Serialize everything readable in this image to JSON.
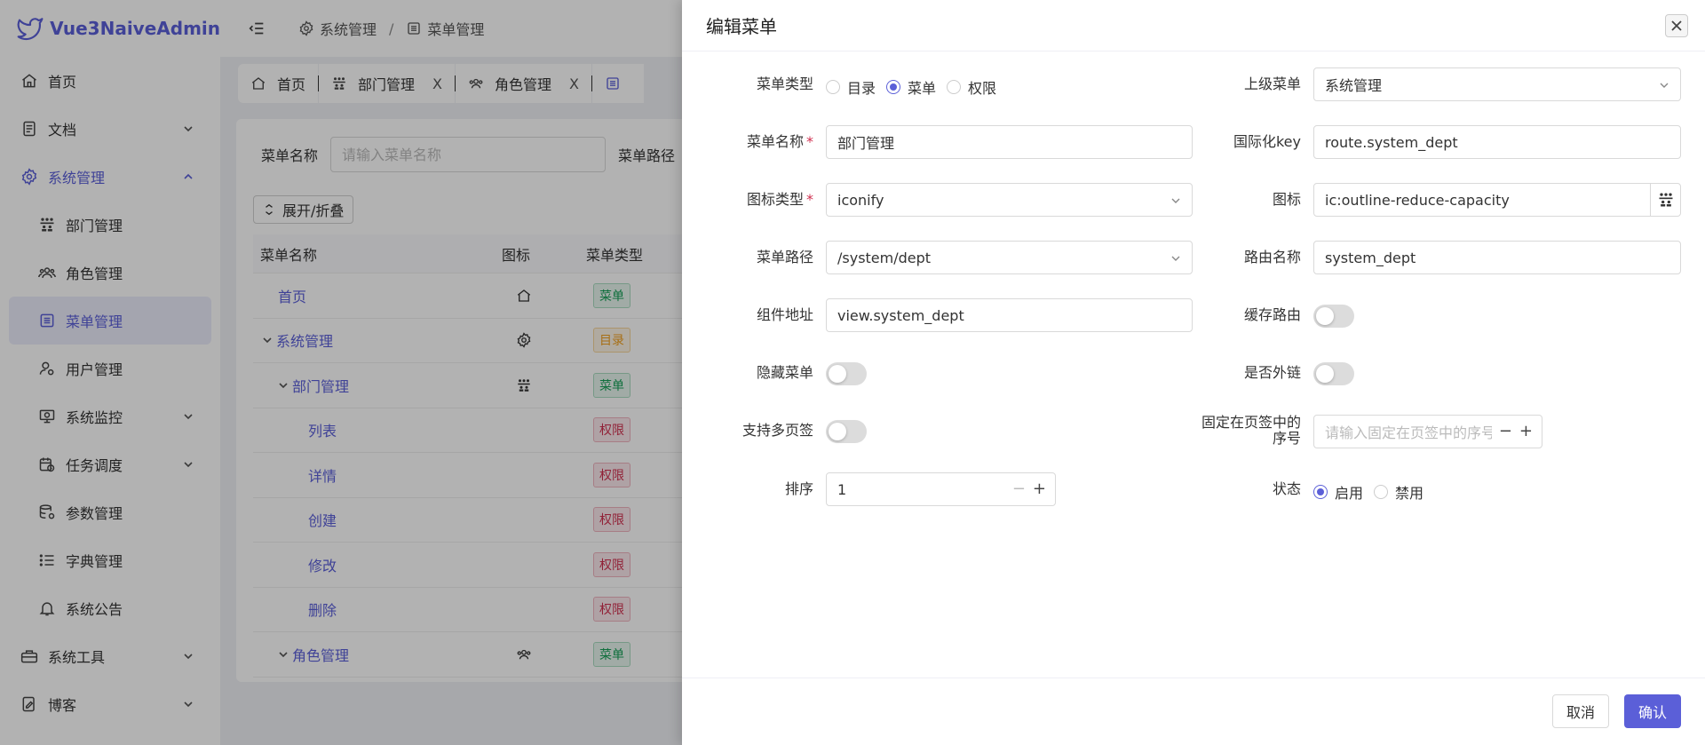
{
  "app": {
    "title": "Vue3NaiveAdmin"
  },
  "sidebar": {
    "items": [
      {
        "label": "首页"
      },
      {
        "label": "文档"
      },
      {
        "label": "系统管理"
      },
      {
        "label": "部门管理"
      },
      {
        "label": "角色管理"
      },
      {
        "label": "菜单管理"
      },
      {
        "label": "用户管理"
      },
      {
        "label": "系统监控"
      },
      {
        "label": "任务调度"
      },
      {
        "label": "参数管理"
      },
      {
        "label": "字典管理"
      },
      {
        "label": "系统公告"
      },
      {
        "label": "系统工具"
      },
      {
        "label": "博客"
      }
    ]
  },
  "breadcrumb": {
    "level1": "系统管理",
    "sep": "/",
    "level2": "菜单管理"
  },
  "tabs": [
    {
      "label": "首页"
    },
    {
      "label": "部门管理",
      "close": "X"
    },
    {
      "label": "角色管理",
      "close": "X"
    }
  ],
  "search": {
    "menu_name_label": "菜单名称",
    "menu_name_placeholder": "请输入菜单名称",
    "menu_path_label": "菜单路径"
  },
  "toolbar": {
    "expand_label": "展开/折叠"
  },
  "table": {
    "headers": [
      "菜单名称",
      "图标",
      "菜单类型"
    ],
    "rows": [
      {
        "name": "首页",
        "type": "菜单"
      },
      {
        "name": "系统管理",
        "type": "目录"
      },
      {
        "name": "部门管理",
        "type": "菜单"
      },
      {
        "name": "列表",
        "type": "权限"
      },
      {
        "name": "详情",
        "type": "权限"
      },
      {
        "name": "创建",
        "type": "权限"
      },
      {
        "name": "修改",
        "type": "权限"
      },
      {
        "name": "删除",
        "type": "权限"
      },
      {
        "name": "角色管理",
        "type": "菜单"
      }
    ]
  },
  "drawer": {
    "title": "编辑菜单",
    "menu_type": {
      "label": "菜单类型",
      "options": [
        "目录",
        "菜单",
        "权限"
      ],
      "selected": "菜单"
    },
    "parent_menu": {
      "label": "上级菜单",
      "value": "系统管理"
    },
    "menu_name": {
      "label": "菜单名称",
      "required": "*",
      "value": "部门管理"
    },
    "i18n_key": {
      "label": "国际化key",
      "value": "route.system_dept"
    },
    "icon_type": {
      "label": "图标类型",
      "required": "*",
      "value": "iconify"
    },
    "icon": {
      "label": "图标",
      "value": "ic:outline-reduce-capacity"
    },
    "menu_path": {
      "label": "菜单路径",
      "value": "/system/dept"
    },
    "route_name": {
      "label": "路由名称",
      "value": "system_dept"
    },
    "component": {
      "label": "组件地址",
      "value": "view.system_dept"
    },
    "keep_alive": {
      "label": "缓存路由",
      "on": false
    },
    "hidden": {
      "label": "隐藏菜单",
      "on": false
    },
    "external": {
      "label": "是否外链",
      "on": false
    },
    "multi_tab": {
      "label": "支持多页签",
      "on": false
    },
    "fixed_index": {
      "label_line1": "固定在页签中的",
      "label_line2": "序号",
      "placeholder": "请输入固定在页签中的序号",
      "minus": "−",
      "plus": "+"
    },
    "sort": {
      "label": "排序",
      "value": "1",
      "minus": "−",
      "plus": "+"
    },
    "status": {
      "label": "状态",
      "options": [
        "启用",
        "禁用"
      ],
      "selected": "启用"
    },
    "cancel_label": "取消",
    "ok_label": "确认"
  },
  "colors": {
    "primary": "#5b5fd8",
    "success": "#18a058",
    "warning": "#f0a020",
    "error": "#d03050"
  }
}
